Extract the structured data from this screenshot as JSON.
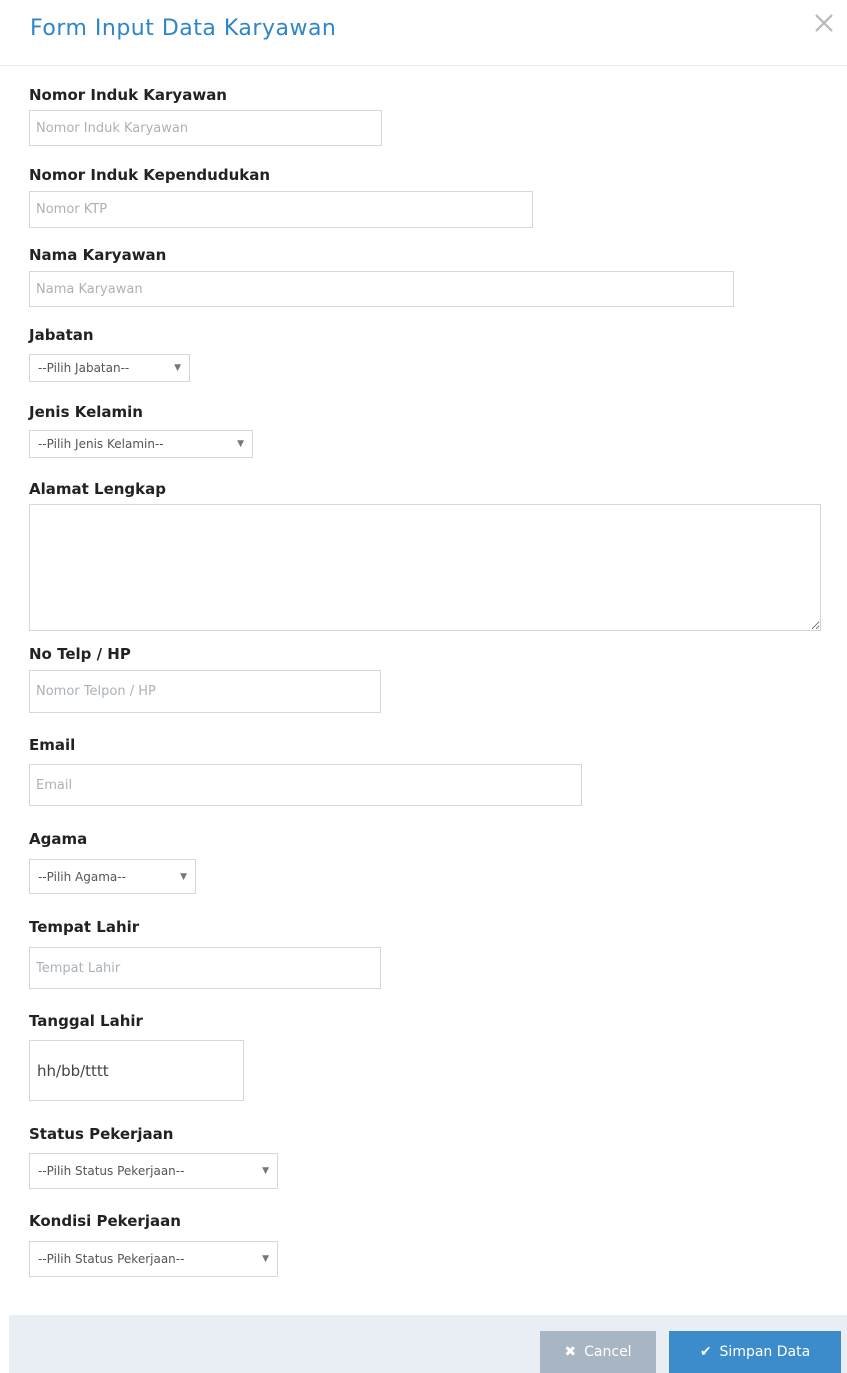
{
  "modal": {
    "title": "Form Input Data Karyawan",
    "close_icon": "close-icon"
  },
  "fields": {
    "nik": {
      "label": "Nomor Induk Karyawan",
      "placeholder": "Nomor Induk Karyawan",
      "value": ""
    },
    "ktp": {
      "label": "Nomor Induk Kependudukan",
      "placeholder": "Nomor KTP",
      "value": ""
    },
    "nama": {
      "label": "Nama Karyawan",
      "placeholder": "Nama Karyawan",
      "value": ""
    },
    "jabatan": {
      "label": "Jabatan",
      "selected": "--Pilih Jabatan--"
    },
    "jenis_kelamin": {
      "label": "Jenis Kelamin",
      "selected": "--Pilih Jenis Kelamin--"
    },
    "alamat": {
      "label": "Alamat Lengkap",
      "value": ""
    },
    "telp": {
      "label": "No Telp / HP",
      "placeholder": "Nomor Telpon / HP",
      "value": ""
    },
    "email": {
      "label": "Email",
      "placeholder": "Email",
      "value": ""
    },
    "agama": {
      "label": "Agama",
      "selected": "--Pilih Agama--"
    },
    "tempat_lahir": {
      "label": "Tempat Lahir",
      "placeholder": "Tempat Lahir",
      "value": ""
    },
    "tanggal_lahir": {
      "label": "Tanggal Lahir",
      "value": "hh/bb/tttt"
    },
    "status_pekerjaan": {
      "label": "Status Pekerjaan",
      "selected": "--Pilih Status Pekerjaan--"
    },
    "kondisi_pekerjaan": {
      "label": "Kondisi Pekerjaan",
      "selected": "--Pilih Status Pekerjaan--"
    }
  },
  "footer": {
    "cancel_label": "Cancel",
    "cancel_icon": "times-icon",
    "save_label": "Simpan Data",
    "save_icon": "check-icon"
  },
  "colors": {
    "title": "#2f86c6",
    "save_button": "#3c8ccb",
    "cancel_button": "#a8b6c4",
    "footer_bg": "#e9edf4"
  }
}
